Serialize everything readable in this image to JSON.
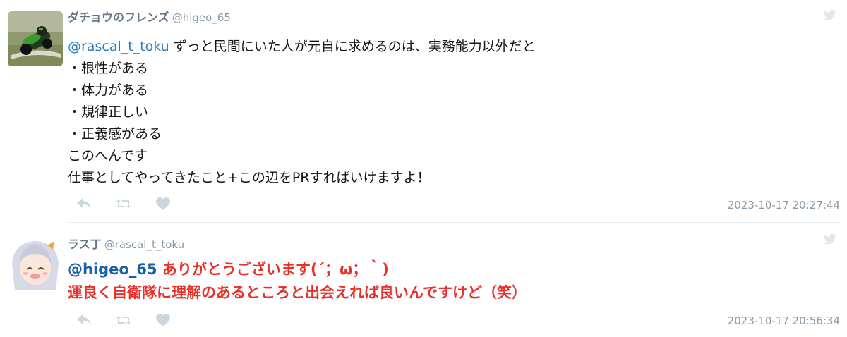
{
  "tweets": [
    {
      "name": "ダチョウのフレンズ",
      "handle": "@higeo_65",
      "mention": "@rascal_t_toku",
      "first_line_rest": " ずっと民間にいた人が元自に求めるのは、実務能力以外だと",
      "lines": [
        "・根性がある",
        "・体力がある",
        "・規律正しい",
        "・正義感がある",
        "このへんです",
        "仕事としてやってきたこと+この辺をPRすればいけますよ！"
      ],
      "timestamp": "2023-10-17 20:27:44",
      "avatar_icon": "motorcycle-racer-avatar"
    },
    {
      "name": "ラス丁",
      "handle": "@rascal_t_toku",
      "mention": "@higeo_65",
      "first_line_rest": " ありがとうございます(´；ω；｀)",
      "lines": [
        "運良く自衛隊に理解のあるところと出会えれば良いんですけど（笑）"
      ],
      "timestamp": "2023-10-17 20:56:34",
      "avatar_icon": "anime-girl-avatar"
    }
  ],
  "actions": [
    "reply-icon",
    "retweet-icon",
    "like-icon"
  ],
  "colors": {
    "mention": "#2b7bb9",
    "reply_text": "#e8312b",
    "meta": "#8899a6",
    "icon": "#ccd6dd"
  }
}
